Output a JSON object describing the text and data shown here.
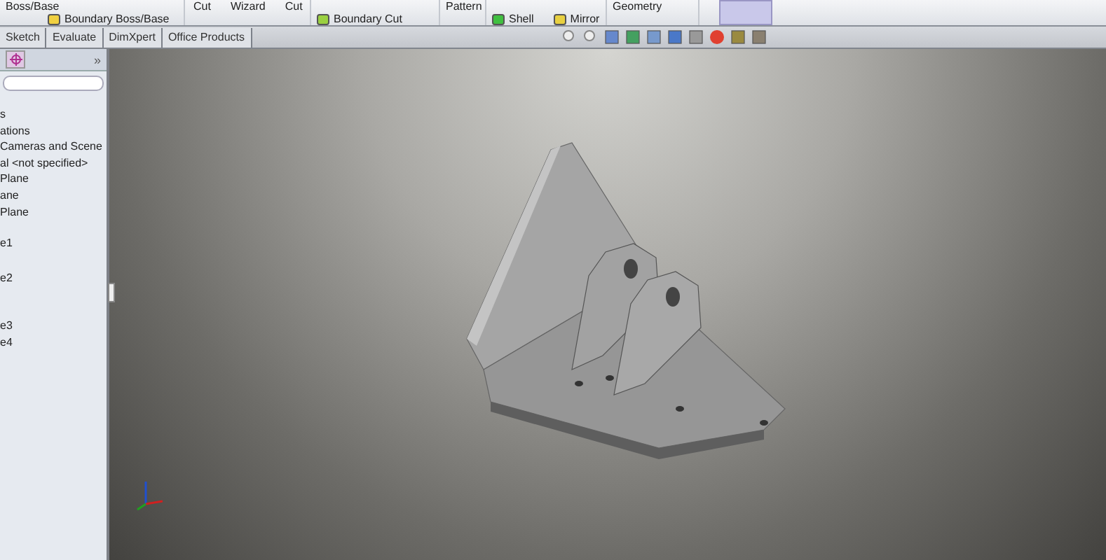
{
  "ribbon": {
    "groups": [
      {
        "top": [
          "Boss/Base"
        ],
        "bottom": [
          "Boundary Boss/Base"
        ]
      },
      {
        "top": [
          "Cut",
          "Wizard",
          "Cut"
        ]
      },
      {
        "bottom": [
          "Boundary Cut"
        ]
      },
      {
        "top": [
          "Pattern"
        ]
      },
      {
        "bottom": [
          "Shell",
          "Mirror"
        ]
      },
      {
        "top": [
          "Geometry"
        ]
      }
    ]
  },
  "tabs": [
    {
      "label": "Sketch",
      "selected": false
    },
    {
      "label": "Evaluate",
      "selected": false
    },
    {
      "label": "DimXpert",
      "selected": false
    },
    {
      "label": "Office Products",
      "selected": false
    }
  ],
  "panel": {
    "collapse": "»",
    "tree": [
      {
        "label": "s"
      },
      {
        "label": "ations"
      },
      {
        "label": "Cameras and Scene"
      },
      {
        "label": "al <not specified>"
      },
      {
        "label": "Plane"
      },
      {
        "label": "ane"
      },
      {
        "label": "Plane"
      },
      {
        "label": "e1"
      },
      {
        "label": "e2"
      },
      {
        "label": "e3"
      },
      {
        "label": "e4"
      }
    ]
  }
}
